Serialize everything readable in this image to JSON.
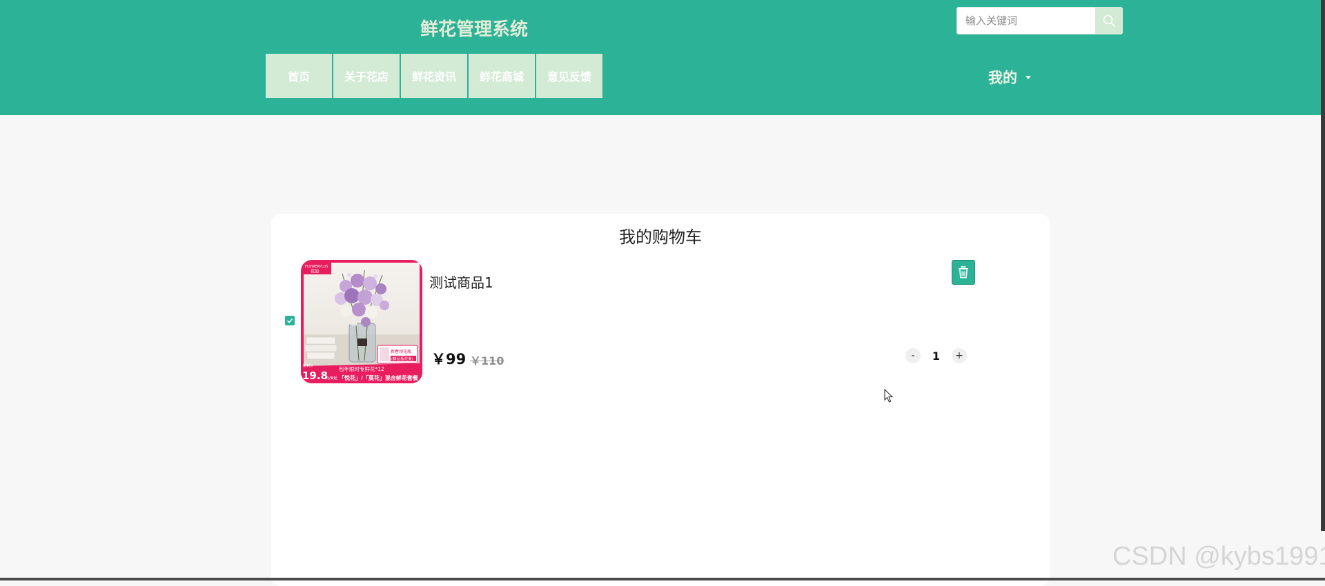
{
  "header": {
    "site_title": "鲜花管理系统",
    "search": {
      "placeholder": "输入关键词",
      "icon": "search-icon"
    },
    "nav": [
      {
        "label": "首页"
      },
      {
        "label": "关于花店"
      },
      {
        "label": "鲜花资讯"
      },
      {
        "label": "鲜花商城"
      },
      {
        "label": "意见反馈"
      }
    ],
    "user_menu": {
      "label": "我的",
      "icon": "caret-down-icon"
    }
  },
  "cart": {
    "title": "我的购物车",
    "items": [
      {
        "checked": true,
        "name": "测试商品1",
        "price": "￥99",
        "original_price": "￥110",
        "quantity": "1",
        "decrement_label": "-",
        "increment_label": "+",
        "delete_icon": "trash-icon",
        "image": {
          "brand": "FLOWERPLUS",
          "brand_cn": "花加",
          "tag": "包年限时专鲜花*12",
          "caption": "「悦花」/「莫花」混合鲜花套餐",
          "price_badge": "19.8",
          "badge_unit": "元/束起",
          "badge_prefix": "新到价",
          "side_note": "新春领花瓶 (精品瓶花束)"
        }
      }
    ]
  },
  "watermark": "CSDN @kybs1991",
  "colors": {
    "primary": "#2bb297",
    "nav_bg": "#d3ead5",
    "page_bg": "#f7f7f7"
  }
}
